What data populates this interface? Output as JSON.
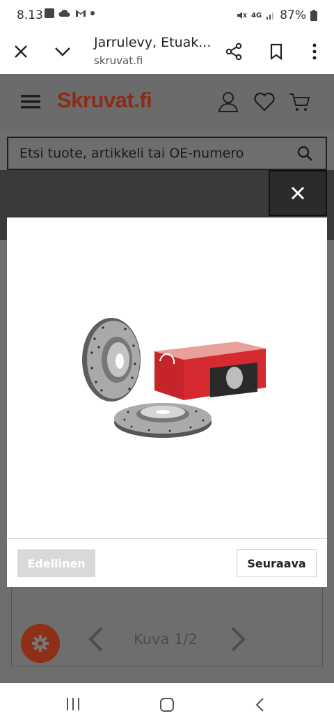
{
  "status": {
    "time": "8.13",
    "battery": "87%",
    "network": "4G"
  },
  "browser": {
    "title": "Jarrulevy, Etuak...",
    "domain": "skruvat.fi"
  },
  "site": {
    "logo": "Skruvat.fi",
    "search_placeholder": "Etsi tuote, artikkeli tai OE-numero"
  },
  "modal": {
    "prev_label": "Edellinen",
    "next_label": "Seuraava"
  },
  "pager": {
    "label": "Kuva 1/2"
  },
  "colors": {
    "brand": "#8c2c18",
    "overlay": "#3a3a3a"
  }
}
